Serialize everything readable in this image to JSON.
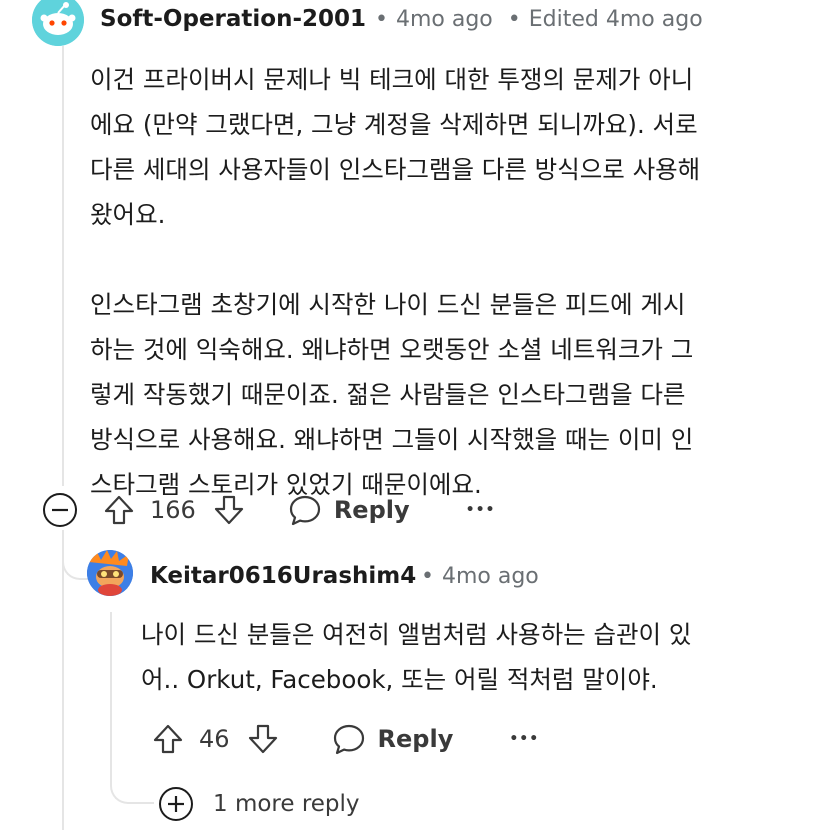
{
  "comment": {
    "username": "Soft-Operation-2001",
    "meta_time": "4mo ago",
    "meta_edited": "Edited 4mo ago",
    "paragraphs": [
      "이건 프라이버시 문제나 빅 테크에 대한 투쟁의 문제가 아니에요 (만약 그랬다면, 그냥 계정을 삭제하면 되니까요). 서로 다른 세대의 사용자들이 인스타그램을 다른 방식으로 사용해 왔어요.",
      "인스타그램 초창기에 시작한 나이 드신 분들은 피드에 게시하는 것에 익숙해요. 왜냐하면 오랫동안 소셜 네트워크가 그렇게 작동했기 때문이죠. 젊은 사람들은 인스타그램을 다른 방식으로 사용해요. 왜냐하면 그들이 시작했을 때는 이미 인스타그램 스토리가 있었기 때문이에요."
    ],
    "paragraph_lines": [
      [
        "이건 프라이버시 문제나 빅 테크에 대한 투쟁의 문제가 아니",
        "에요 (만약 그랬다면, 그냥 계정을 삭제하면 되니까요). 서로",
        "다른 세대의 사용자들이 인스타그램을 다른 방식으로 사용해",
        "왔어요."
      ],
      [
        "인스타그램 초창기에 시작한 나이 드신 분들은 피드에 게시",
        "하는 것에 익숙해요. 왜냐하면 오랫동안 소셜 네트워크가 그",
        "렇게 작동했기 때문이죠. 젊은 사람들은 인스타그램을 다른",
        "방식으로 사용해요. 왜냐하면 그들이 시작했을 때는 이미 인",
        "스타그램 스토리가 있었기 때문이에요."
      ]
    ],
    "vote_count": "166",
    "reply_label": "Reply",
    "more_label": "•••",
    "avatar_color": "#5fd3dc"
  },
  "reply": {
    "username": "Keitar0616Urashim4",
    "meta_time": "4mo ago",
    "lines": [
      "나이 드신 분들은 여전히 앨범처럼 사용하는 습관이 있",
      "어.. Orkut, Facebook, 또는 어릴 적처럼 말이야."
    ],
    "vote_count": "46",
    "reply_label": "Reply",
    "more_label": "•••"
  },
  "more_replies_label": "1 more reply",
  "separator": "•"
}
